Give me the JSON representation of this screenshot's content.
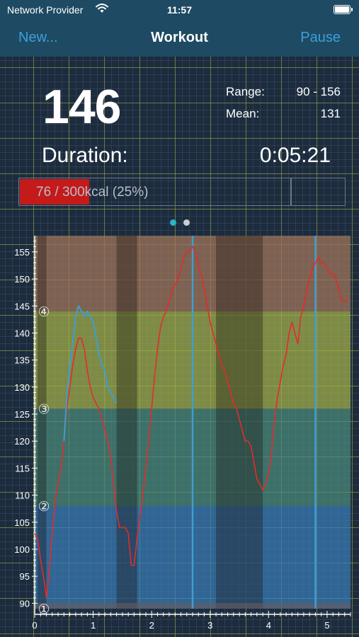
{
  "status": {
    "carrier": "Network Provider",
    "time": "11:57"
  },
  "nav": {
    "left": "New...",
    "title": "Workout",
    "right": "Pause"
  },
  "stats": {
    "heart_rate": "146",
    "range_label": "Range:",
    "range_value": "90 - 156",
    "mean_label": "Mean:",
    "mean_value": "131",
    "duration_label": "Duration:",
    "duration_value": "0:05:21"
  },
  "progress": {
    "text": "76 / 300kcal (25%)",
    "fraction": 0.25
  },
  "pager": {
    "count": 2,
    "active": 0,
    "active_color": "#2bb3c8",
    "inactive_color": "#c9cdd2"
  },
  "colors": {
    "accent": "#3aa0dc",
    "heart_line": "#e52b2b",
    "secondary_line": "#3f9ed0"
  },
  "chart_data": {
    "type": "line",
    "xlim": [
      0,
      5.4
    ],
    "ylim": [
      89,
      158
    ],
    "x_ticks": [
      0,
      1,
      2,
      3,
      4,
      5
    ],
    "y_ticks": [
      90,
      95,
      100,
      105,
      110,
      115,
      120,
      125,
      130,
      135,
      140,
      145,
      150,
      155
    ],
    "zones": [
      {
        "label": "①",
        "from": 89,
        "to": 108,
        "color": "#3a7bb5"
      },
      {
        "label": "②",
        "from": 108,
        "to": 126,
        "color": "#4c8a7c"
      },
      {
        "label": "③",
        "from": 126,
        "to": 144,
        "color": "#a4b04a"
      },
      {
        "label": "④",
        "from": 144,
        "to": 158,
        "color": "#a4765a"
      }
    ],
    "dark_bands": [
      [
        0.05,
        0.2
      ],
      [
        1.4,
        1.75
      ],
      [
        3.1,
        3.9
      ]
    ],
    "markers": [
      2.7,
      4.8
    ],
    "series": [
      {
        "x": [
          0,
          0.05,
          0.1,
          0.15,
          0.2,
          0.25,
          0.3,
          0.35,
          0.4,
          0.45,
          0.5,
          0.55,
          0.6,
          0.65,
          0.7,
          0.75,
          0.8,
          0.85,
          0.9,
          0.95,
          1.0,
          1.05,
          1.1,
          1.15,
          1.2,
          1.25,
          1.3,
          1.35,
          1.4,
          1.45,
          1.5,
          1.55,
          1.6,
          1.65,
          1.7,
          1.75,
          1.8,
          1.85,
          1.9,
          1.95,
          2.0,
          2.05,
          2.1,
          2.15,
          2.2,
          2.25,
          2.3,
          2.35,
          2.4,
          2.45,
          2.5,
          2.55,
          2.6,
          2.65,
          2.7,
          2.75,
          2.8,
          2.85,
          2.9,
          2.95,
          3.0,
          3.05,
          3.1,
          3.15,
          3.2,
          3.25,
          3.3,
          3.35,
          3.4,
          3.45,
          3.5,
          3.55,
          3.6,
          3.65,
          3.7,
          3.75,
          3.8,
          3.85,
          3.9,
          3.95,
          4.0,
          4.05,
          4.1,
          4.15,
          4.2,
          4.25,
          4.3,
          4.35,
          4.4,
          4.45,
          4.5,
          4.55,
          4.6,
          4.65,
          4.7,
          4.75,
          4.8,
          4.85,
          4.9,
          4.95,
          5.0,
          5.05,
          5.1,
          5.15,
          5.2,
          5.25,
          5.3,
          5.35
        ],
        "y": [
          103,
          102,
          98,
          95,
          91,
          96,
          103,
          109,
          112,
          115,
          120,
          126,
          130,
          134,
          137,
          139,
          139,
          137,
          133,
          130,
          128,
          127,
          126,
          124,
          122,
          120,
          117,
          112,
          107,
          104,
          104,
          104,
          103,
          97,
          97,
          102,
          106,
          110,
          115,
          120,
          126,
          132,
          137,
          141,
          143,
          144,
          146,
          148,
          149,
          150,
          152,
          154,
          155,
          155,
          156,
          155,
          152,
          151,
          148,
          145,
          142,
          140,
          138,
          136,
          134,
          133,
          131,
          129,
          127,
          126,
          124,
          122,
          120,
          120,
          119,
          116,
          113,
          112,
          111,
          112,
          114,
          118,
          124,
          128,
          131,
          134,
          136,
          140,
          142,
          140,
          138,
          143,
          145,
          148,
          150,
          152,
          153,
          154,
          153,
          153,
          152,
          151,
          151,
          150,
          148,
          146,
          146,
          146
        ]
      },
      {
        "x": [
          0.5,
          0.55,
          0.6,
          0.65,
          0.7,
          0.75,
          0.8,
          0.85,
          0.9,
          0.95,
          1.0,
          1.05,
          1.1,
          1.15,
          1.2,
          1.25,
          1.3,
          1.35,
          1.4
        ],
        "y": [
          120,
          128,
          134,
          138,
          143,
          145,
          144,
          143,
          144,
          143,
          142,
          139,
          136,
          134,
          133,
          130,
          129,
          128,
          127
        ]
      }
    ]
  }
}
